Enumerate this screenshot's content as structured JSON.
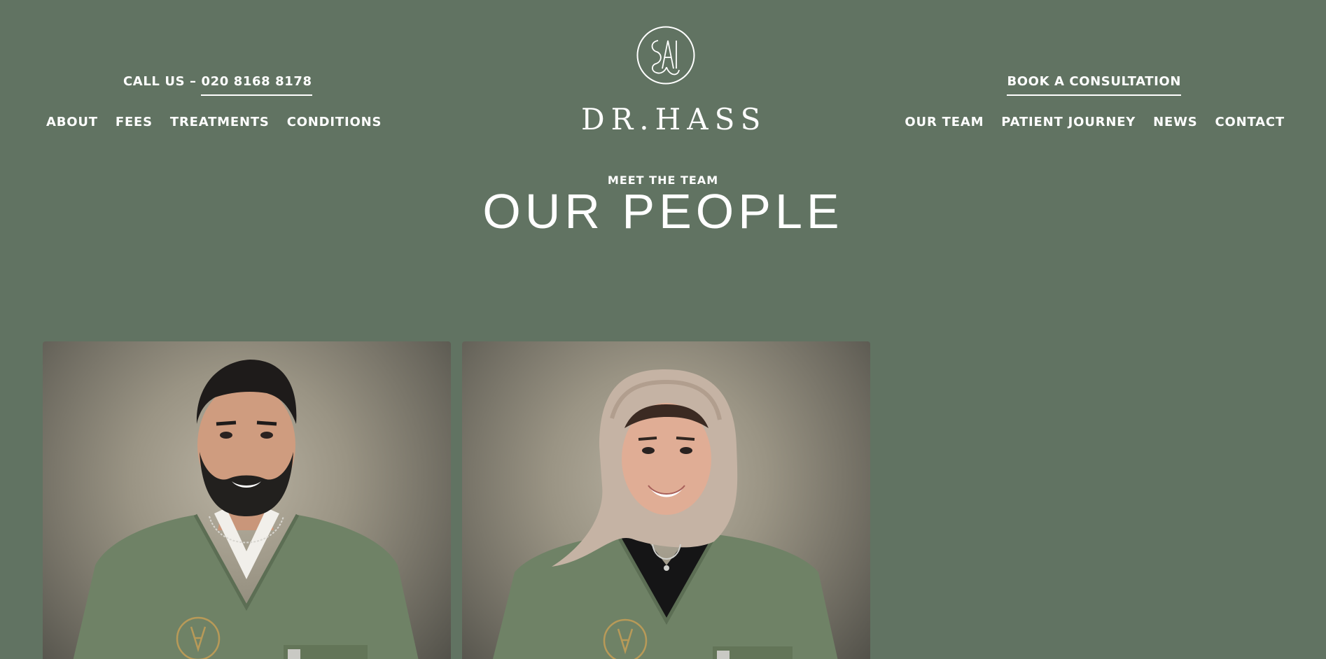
{
  "brand": {
    "name": "DR.HASS",
    "colors": {
      "background": "#617362",
      "text": "#ffffff",
      "scrubs": "#6f8266",
      "accent_gold": "#b89a58"
    }
  },
  "header": {
    "call_prefix": "CALL US – ",
    "call_number": "020 8168 8178",
    "book_label": "BOOK A CONSULTATION",
    "nav_left": [
      "ABOUT",
      "FEES",
      "TREATMENTS",
      "CONDITIONS"
    ],
    "nav_right": [
      "OUR TEAM",
      "PATIENT JOURNEY",
      "NEWS",
      "CONTACT"
    ]
  },
  "hero": {
    "eyebrow": "MEET THE TEAM",
    "title": "OUR PEOPLE"
  },
  "team": {
    "cards": [
      {
        "icon": "portrait-man-photo"
      },
      {
        "icon": "portrait-woman-photo"
      }
    ]
  }
}
